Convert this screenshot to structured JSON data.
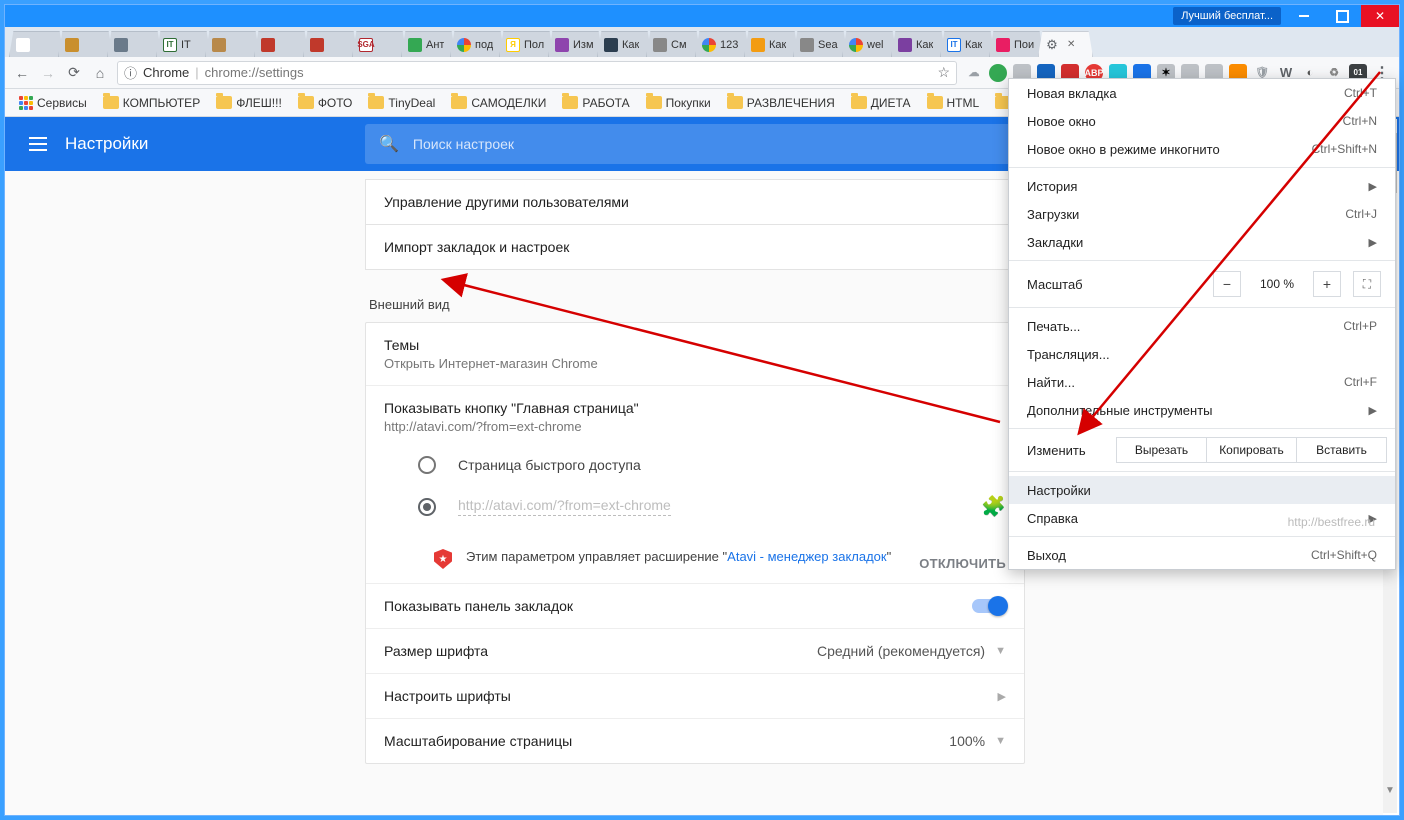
{
  "window": {
    "title_badge": "Лучший бесплат..."
  },
  "tabs": [
    {
      "label": "",
      "fav": "#fff"
    },
    {
      "label": "",
      "fav": "#c98f2e"
    },
    {
      "label": "",
      "fav": "#6a7a8a"
    },
    {
      "label": "IT",
      "fav": "#2e6d35",
      "text": "IT"
    },
    {
      "label": "",
      "fav": "#b8894a"
    },
    {
      "label": "",
      "fav": "#c0392b"
    },
    {
      "label": "",
      "fav": "#c0392b"
    },
    {
      "label": "",
      "fav": "#b0272f",
      "text": "SGA"
    },
    {
      "label": "Ант",
      "fav": "#34a853"
    },
    {
      "label": "под",
      "fav": "#4285f4",
      "g": true
    },
    {
      "label": "Пол",
      "fav": "#ffcc00",
      "text": "Я"
    },
    {
      "label": "Изм",
      "fav": "#8e44ad"
    },
    {
      "label": "Как",
      "fav": "#2c3e50"
    },
    {
      "label": "См",
      "fav": "#888"
    },
    {
      "label": "123",
      "fav": "#4285f4",
      "g": true
    },
    {
      "label": "Как",
      "fav": "#f39c12"
    },
    {
      "label": "Sea",
      "fav": "#888"
    },
    {
      "label": "wel",
      "fav": "#4285f4",
      "g": true
    },
    {
      "label": "Как",
      "fav": "#7b3fa0"
    },
    {
      "label": "Как",
      "fav": "#1a73e8",
      "text": "IT"
    },
    {
      "label": "Пои",
      "fav": "#e91e63"
    },
    {
      "label": "",
      "fav": "#5f6368",
      "active": true,
      "gear": true
    }
  ],
  "omni": {
    "scheme_icon": "ⓘ",
    "host": "Chrome",
    "path": "chrome://settings"
  },
  "bookmarks": {
    "apps": "Сервисы",
    "folders": [
      "КОМПЬЮТЕР",
      "ФЛЕШ!!!",
      "ФОТО",
      "TinyDeal",
      "САМОДЕЛКИ",
      "РАБОТА",
      "Покупки",
      "РАЗВЛЕЧЕНИЯ",
      "ДИЕТА",
      "HTML",
      ""
    ]
  },
  "header": {
    "title": "Настройки",
    "search_ph": "Поиск настроек"
  },
  "links": {
    "manage_users": "Управление другими пользователями",
    "import": "Импорт закладок и настроек"
  },
  "appearance": {
    "section": "Внешний вид",
    "themes_title": "Темы",
    "themes_sub": "Открыть Интернет-магазин Chrome",
    "home_title": "Показывать кнопку \"Главная страница\"",
    "home_sub": "http://atavi.com/?from=ext-chrome",
    "radio1": "Страница быстрого доступа",
    "radio2_ph": "http://atavi.com/?from=ext-chrome",
    "ext_note_1": "Этим параметром управляет расширение \"",
    "ext_link": "Atavi - менеджер закладок",
    "ext_note_2": "\"",
    "disable": "ОТКЛЮЧИТЬ",
    "show_bm": "Показывать панель закладок",
    "font_size": "Размер шрифта",
    "font_size_val": "Средний (рекомендуется)",
    "customize_fonts": "Настроить шрифты",
    "zoom": "Масштабирование страницы",
    "zoom_val": "100%"
  },
  "menu": {
    "new_tab": {
      "l": "Новая вкладка",
      "s": "Ctrl+T"
    },
    "new_win": {
      "l": "Новое окно",
      "s": "Ctrl+N"
    },
    "incog": {
      "l": "Новое окно в режиме инкогнито",
      "s": "Ctrl+Shift+N"
    },
    "history": {
      "l": "История"
    },
    "downloads": {
      "l": "Загрузки",
      "s": "Ctrl+J"
    },
    "bookmarks": {
      "l": "Закладки"
    },
    "zoom": {
      "l": "Масштаб",
      "v": "100 %"
    },
    "print": {
      "l": "Печать...",
      "s": "Ctrl+P"
    },
    "cast": {
      "l": "Трансляция..."
    },
    "find": {
      "l": "Найти...",
      "s": "Ctrl+F"
    },
    "more": {
      "l": "Дополнительные инструменты"
    },
    "edit": {
      "l": "Изменить",
      "cut": "Вырезать",
      "copy": "Копировать",
      "paste": "Вставить"
    },
    "settings": {
      "l": "Настройки"
    },
    "help": {
      "l": "Справка"
    },
    "exit": {
      "l": "Выход",
      "s": "Ctrl+Shift+Q"
    }
  },
  "watermark": "http://bestfree.ru"
}
